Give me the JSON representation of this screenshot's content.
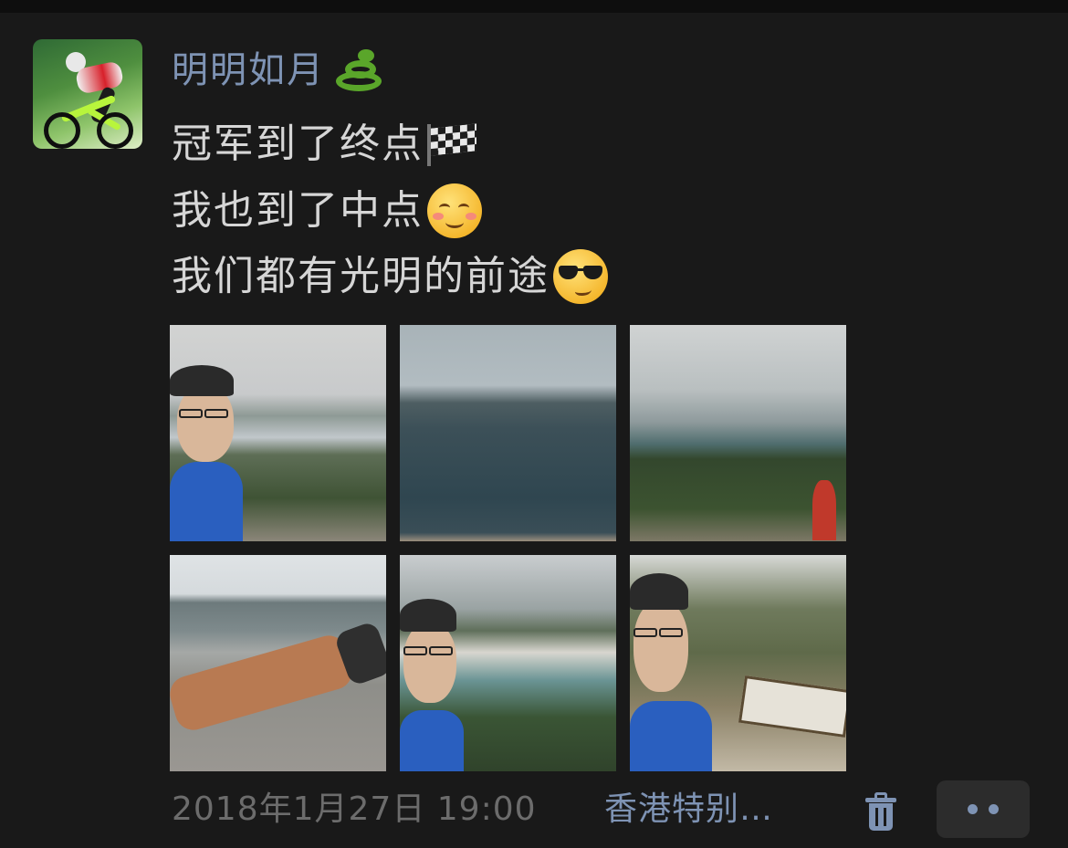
{
  "post": {
    "author": "明明如月",
    "author_emoji": "snake-emoji",
    "lines": [
      {
        "text": "冠军到了终点",
        "emoji": "checkered-flag-emoji"
      },
      {
        "text": "我也到了中点",
        "emoji": "smiling-face-emoji"
      },
      {
        "text": "我们都有光明的前途",
        "emoji": "sunglasses-face-emoji"
      }
    ],
    "photos": [
      {
        "id": "selfie-lake-view"
      },
      {
        "id": "sea-view"
      },
      {
        "id": "hiking-trail-view"
      },
      {
        "id": "beach-arm-tattoo"
      },
      {
        "id": "selfie-bay-view"
      },
      {
        "id": "selfie-signpost"
      }
    ],
    "timestamp": "2018年1月27日 19:00",
    "location": "香港特别…"
  },
  "colors": {
    "background": "#191919",
    "name_link": "#7e93b4",
    "text": "#d6d6d6",
    "meta": "#6c6c6c",
    "button_bg": "#2c2c2c"
  },
  "icons": {
    "delete": "trash-icon",
    "more": "more-dots-icon"
  }
}
